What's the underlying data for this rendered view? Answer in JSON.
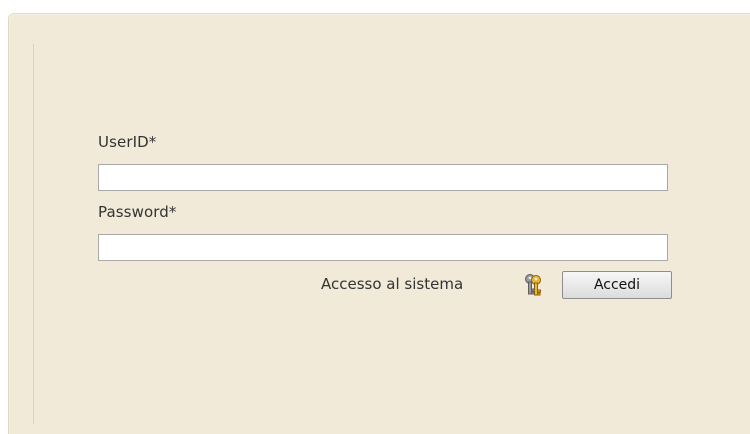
{
  "login": {
    "userid_label": "UserID*",
    "userid_value": "",
    "password_label": "Password*",
    "password_value": "",
    "access_text": "Accesso al sistema",
    "submit_label": "Accedi",
    "key_icon": "keys-icon"
  },
  "colors": {
    "panel_background": "#f1ead8",
    "text": "#333333",
    "input_border": "#a9a9a9"
  }
}
